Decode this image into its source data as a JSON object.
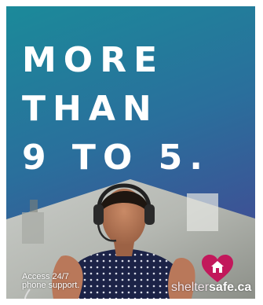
{
  "ad": {
    "headline_lines": [
      "MORE",
      "THAN",
      "9 TO 5."
    ],
    "caption_lines": [
      "Access 24/7",
      "phone support."
    ],
    "logo": {
      "name_part1": "shelter",
      "name_part2": "safe.ca"
    },
    "colors": {
      "gradient_top": "#1b8a9a",
      "gradient_bottom": "#4b4590",
      "headline": "#ffffff",
      "logo_heart": "#c2185b"
    }
  }
}
